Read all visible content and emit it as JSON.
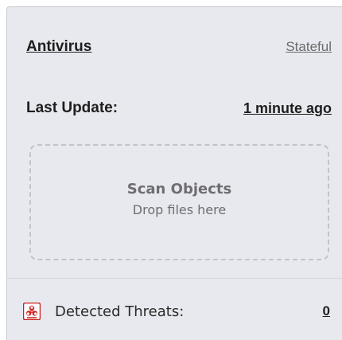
{
  "antivirus": {
    "title": "Antivirus",
    "state": "Stateful",
    "last_update_label": "Last Update:",
    "last_update_value": "1 minute ago"
  },
  "scan": {
    "title": "Scan Objects",
    "subtitle": "Drop files here"
  },
  "threats": {
    "label": "Detected Threats:",
    "count": "0",
    "icon": "biohazard-icon",
    "icon_color": "#cc1f1f"
  },
  "colors": {
    "panel_bg": "#e8e9ee",
    "text_dark": "#1e1e1e",
    "text_muted": "#6d6d72"
  }
}
